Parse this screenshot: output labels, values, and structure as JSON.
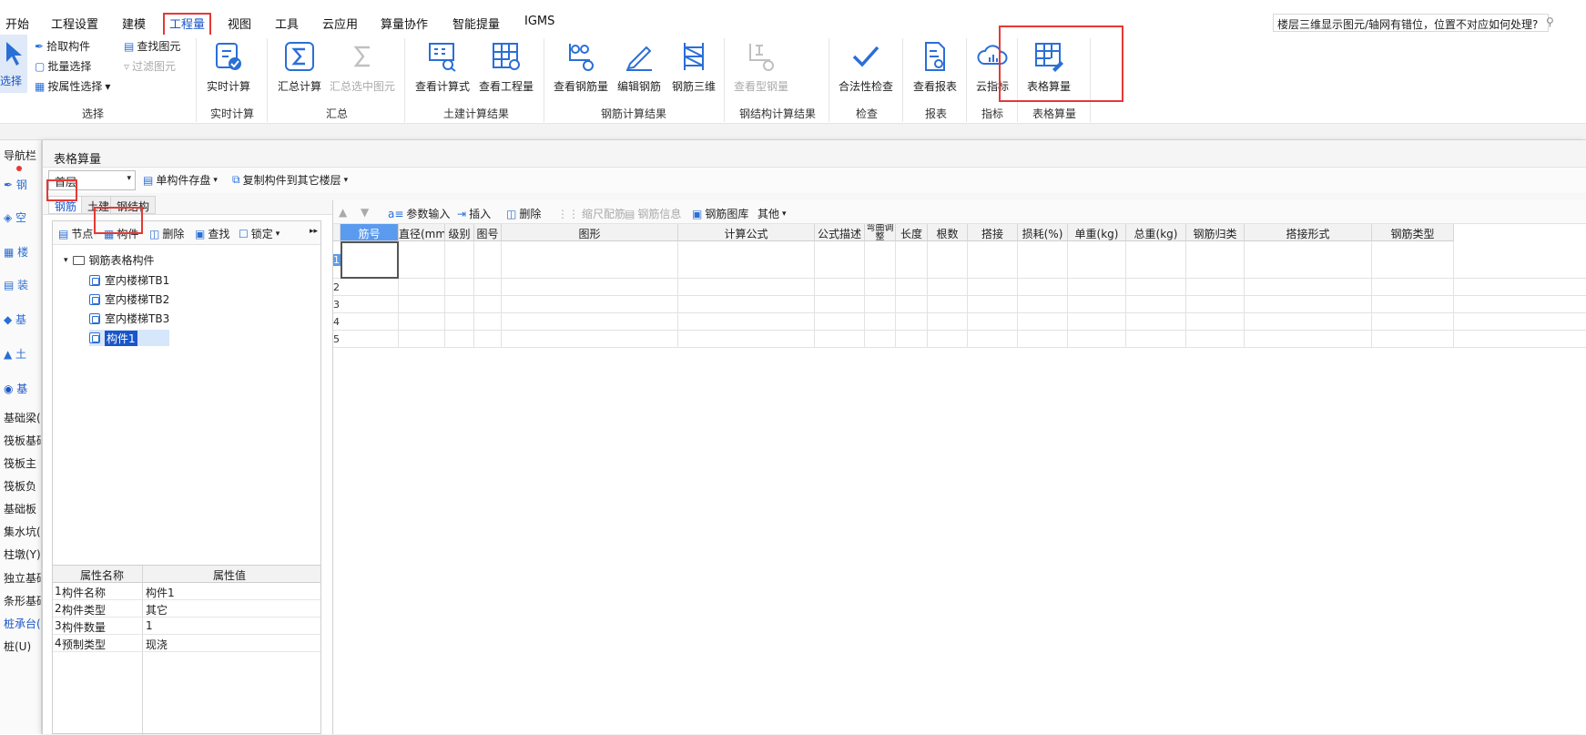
{
  "menubar": {
    "items": [
      "开始",
      "工程设置",
      "建模",
      "工程量",
      "视图",
      "工具",
      "云应用",
      "算量协作",
      "智能提量",
      "IGMS"
    ],
    "active": "工程量",
    "help_search": "楼层三维显示图元/轴网有错位，位置不对应如何处理?"
  },
  "ribbon": {
    "select_group": {
      "select_label": "选择",
      "pick": "拾取构件",
      "batch": "批量选择",
      "by_attr": "按属性选择",
      "find": "查找图元",
      "filter": "过滤图元",
      "label": "选择"
    },
    "realtime": {
      "calc": "实时计算",
      "label": "实时计算"
    },
    "summary": {
      "calc": "汇总计算",
      "selected": "汇总选中图元",
      "label": "汇总"
    },
    "civil": {
      "formula": "查看计算式",
      "quantity": "查看工程量",
      "label": "土建计算结果"
    },
    "rebar": {
      "view": "查看钢筋量",
      "edit": "编辑钢筋",
      "three_d": "钢筋三维",
      "label": "钢筋计算结果"
    },
    "steel": {
      "view": "查看型钢量",
      "label": "钢结构计算结果"
    },
    "check": {
      "legal": "合法性检查",
      "label": "检查"
    },
    "report": {
      "view": "查看报表",
      "label": "报表"
    },
    "indicator": {
      "cloud": "云指标",
      "label": "指标"
    },
    "table_calc": {
      "btn": "表格算量",
      "label": "表格算量"
    }
  },
  "leftnav": {
    "header": "导航栏",
    "items": [
      "基础梁(",
      "筏板基础",
      "筏板主",
      "筏板负",
      "基础板",
      "集水坑(",
      "柱墩(Y)",
      "独立基础",
      "条形基础",
      "桩承台(",
      "桩(U)"
    ],
    "active_index": 9,
    "icon_labels": [
      "钢",
      "空",
      "楼",
      "装",
      "基",
      "土",
      "基"
    ]
  },
  "dialog": {
    "title": "表格算量",
    "floor_select": "首层",
    "save_btn": "单构件存盘",
    "copy_btn": "复制构件到其它楼层",
    "tabs": [
      "钢筋",
      "土建",
      "钢结构"
    ],
    "active_tab": "钢筋"
  },
  "leftpane": {
    "toolbar": {
      "node": "节点",
      "component": "构件",
      "delete": "删除",
      "find": "查找",
      "lock": "锁定"
    },
    "tree_root": "钢筋表格构件",
    "tree_items": [
      "室内楼梯TB1",
      "室内楼梯TB2",
      "室内楼梯TB3",
      "构件1"
    ]
  },
  "proptable": {
    "headers": [
      "属性名称",
      "属性值"
    ],
    "rows": [
      {
        "num": "1",
        "name": "构件名称",
        "value": "构件1"
      },
      {
        "num": "2",
        "name": "构件类型",
        "value": "其它"
      },
      {
        "num": "3",
        "name": "构件数量",
        "value": "1"
      },
      {
        "num": "4",
        "name": "预制类型",
        "value": "现浇"
      }
    ]
  },
  "rightpane": {
    "toolbar": {
      "param": "参数输入",
      "insert": "插入",
      "delete": "删除",
      "scale": "缩尺配筋",
      "info": "钢筋信息",
      "lib": "钢筋图库",
      "other": "其他"
    },
    "columns": [
      "筋号",
      "直径(mm)",
      "级别",
      "图号",
      "图形",
      "计算公式",
      "公式描述",
      "弯曲调整",
      "长度",
      "根数",
      "搭接",
      "损耗(%)",
      "单重(kg)",
      "总重(kg)",
      "钢筋归类",
      "搭接形式",
      "钢筋类型"
    ],
    "row_numbers": [
      "1",
      "2",
      "3",
      "4",
      "5"
    ]
  },
  "colors": {
    "accent": "#1a56c9",
    "highlight": "#e53935",
    "header_sel": "#5b9bef"
  }
}
